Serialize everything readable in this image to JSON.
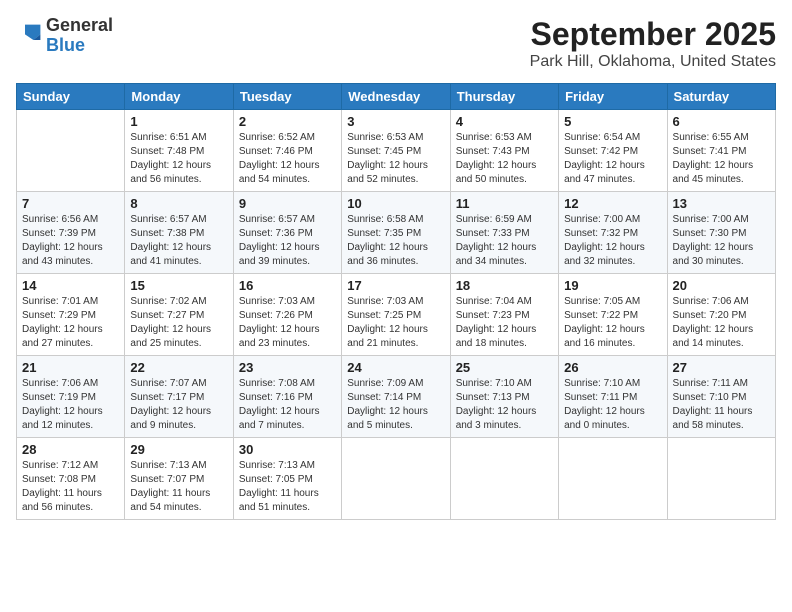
{
  "header": {
    "logo": {
      "line1": "General",
      "line2": "Blue"
    },
    "title": "September 2025",
    "subtitle": "Park Hill, Oklahoma, United States"
  },
  "calendar": {
    "days_of_week": [
      "Sunday",
      "Monday",
      "Tuesday",
      "Wednesday",
      "Thursday",
      "Friday",
      "Saturday"
    ],
    "weeks": [
      [
        {
          "day": "",
          "info": ""
        },
        {
          "day": "1",
          "info": "Sunrise: 6:51 AM\nSunset: 7:48 PM\nDaylight: 12 hours\nand 56 minutes."
        },
        {
          "day": "2",
          "info": "Sunrise: 6:52 AM\nSunset: 7:46 PM\nDaylight: 12 hours\nand 54 minutes."
        },
        {
          "day": "3",
          "info": "Sunrise: 6:53 AM\nSunset: 7:45 PM\nDaylight: 12 hours\nand 52 minutes."
        },
        {
          "day": "4",
          "info": "Sunrise: 6:53 AM\nSunset: 7:43 PM\nDaylight: 12 hours\nand 50 minutes."
        },
        {
          "day": "5",
          "info": "Sunrise: 6:54 AM\nSunset: 7:42 PM\nDaylight: 12 hours\nand 47 minutes."
        },
        {
          "day": "6",
          "info": "Sunrise: 6:55 AM\nSunset: 7:41 PM\nDaylight: 12 hours\nand 45 minutes."
        }
      ],
      [
        {
          "day": "7",
          "info": "Sunrise: 6:56 AM\nSunset: 7:39 PM\nDaylight: 12 hours\nand 43 minutes."
        },
        {
          "day": "8",
          "info": "Sunrise: 6:57 AM\nSunset: 7:38 PM\nDaylight: 12 hours\nand 41 minutes."
        },
        {
          "day": "9",
          "info": "Sunrise: 6:57 AM\nSunset: 7:36 PM\nDaylight: 12 hours\nand 39 minutes."
        },
        {
          "day": "10",
          "info": "Sunrise: 6:58 AM\nSunset: 7:35 PM\nDaylight: 12 hours\nand 36 minutes."
        },
        {
          "day": "11",
          "info": "Sunrise: 6:59 AM\nSunset: 7:33 PM\nDaylight: 12 hours\nand 34 minutes."
        },
        {
          "day": "12",
          "info": "Sunrise: 7:00 AM\nSunset: 7:32 PM\nDaylight: 12 hours\nand 32 minutes."
        },
        {
          "day": "13",
          "info": "Sunrise: 7:00 AM\nSunset: 7:30 PM\nDaylight: 12 hours\nand 30 minutes."
        }
      ],
      [
        {
          "day": "14",
          "info": "Sunrise: 7:01 AM\nSunset: 7:29 PM\nDaylight: 12 hours\nand 27 minutes."
        },
        {
          "day": "15",
          "info": "Sunrise: 7:02 AM\nSunset: 7:27 PM\nDaylight: 12 hours\nand 25 minutes."
        },
        {
          "day": "16",
          "info": "Sunrise: 7:03 AM\nSunset: 7:26 PM\nDaylight: 12 hours\nand 23 minutes."
        },
        {
          "day": "17",
          "info": "Sunrise: 7:03 AM\nSunset: 7:25 PM\nDaylight: 12 hours\nand 21 minutes."
        },
        {
          "day": "18",
          "info": "Sunrise: 7:04 AM\nSunset: 7:23 PM\nDaylight: 12 hours\nand 18 minutes."
        },
        {
          "day": "19",
          "info": "Sunrise: 7:05 AM\nSunset: 7:22 PM\nDaylight: 12 hours\nand 16 minutes."
        },
        {
          "day": "20",
          "info": "Sunrise: 7:06 AM\nSunset: 7:20 PM\nDaylight: 12 hours\nand 14 minutes."
        }
      ],
      [
        {
          "day": "21",
          "info": "Sunrise: 7:06 AM\nSunset: 7:19 PM\nDaylight: 12 hours\nand 12 minutes."
        },
        {
          "day": "22",
          "info": "Sunrise: 7:07 AM\nSunset: 7:17 PM\nDaylight: 12 hours\nand 9 minutes."
        },
        {
          "day": "23",
          "info": "Sunrise: 7:08 AM\nSunset: 7:16 PM\nDaylight: 12 hours\nand 7 minutes."
        },
        {
          "day": "24",
          "info": "Sunrise: 7:09 AM\nSunset: 7:14 PM\nDaylight: 12 hours\nand 5 minutes."
        },
        {
          "day": "25",
          "info": "Sunrise: 7:10 AM\nSunset: 7:13 PM\nDaylight: 12 hours\nand 3 minutes."
        },
        {
          "day": "26",
          "info": "Sunrise: 7:10 AM\nSunset: 7:11 PM\nDaylight: 12 hours\nand 0 minutes."
        },
        {
          "day": "27",
          "info": "Sunrise: 7:11 AM\nSunset: 7:10 PM\nDaylight: 11 hours\nand 58 minutes."
        }
      ],
      [
        {
          "day": "28",
          "info": "Sunrise: 7:12 AM\nSunset: 7:08 PM\nDaylight: 11 hours\nand 56 minutes."
        },
        {
          "day": "29",
          "info": "Sunrise: 7:13 AM\nSunset: 7:07 PM\nDaylight: 11 hours\nand 54 minutes."
        },
        {
          "day": "30",
          "info": "Sunrise: 7:13 AM\nSunset: 7:05 PM\nDaylight: 11 hours\nand 51 minutes."
        },
        {
          "day": "",
          "info": ""
        },
        {
          "day": "",
          "info": ""
        },
        {
          "day": "",
          "info": ""
        },
        {
          "day": "",
          "info": ""
        }
      ]
    ]
  }
}
